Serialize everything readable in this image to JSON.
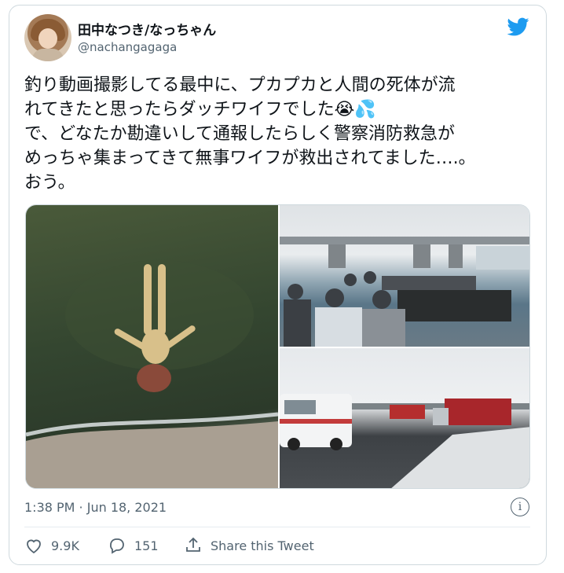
{
  "tweet": {
    "author_name": "田中なつき/なっちゃん",
    "author_handle": "@nachangagaga",
    "text": "釣り動画撮影してる最中に、プカプカと人間の死体が流\nれてきたと思ったらダッチワイフでした😭💦\nで、どなたか勘違いして通報したらしく警察消防救急が\nめっちゃ集まってきて無事ワイフが救出されてました….。\nおう。",
    "timestamp": "1:38 PM · Jun 18, 2021",
    "likes": "9.9K",
    "replies": "151",
    "share_label": "Share this Tweet"
  },
  "icons": {
    "brand": "twitter-bird-icon",
    "like": "heart-icon",
    "reply": "speech-bubble-icon",
    "share": "share-icon",
    "info": "info-icon"
  },
  "colors": {
    "twitter_blue": "#1d9bf0",
    "secondary_text": "#536471",
    "border": "#cfd9de"
  }
}
